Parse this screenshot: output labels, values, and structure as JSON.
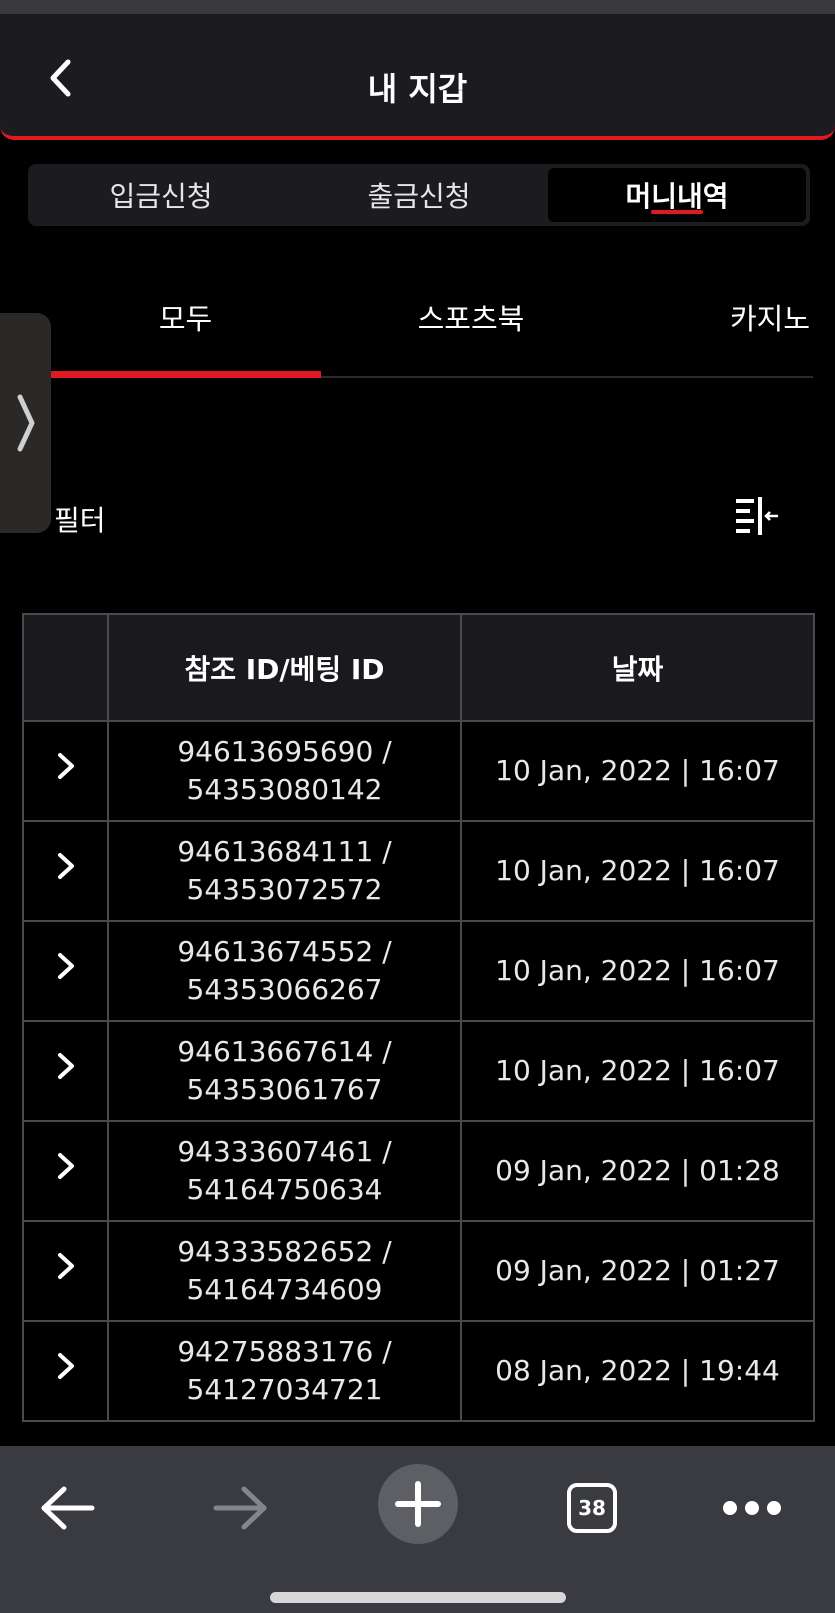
{
  "header": {
    "title": "내 지갑"
  },
  "segment": {
    "items": [
      "입금신청",
      "출금신청",
      "머니내역"
    ],
    "active": 2
  },
  "tabs": {
    "items": [
      "모두",
      "스포츠북",
      "카지노"
    ],
    "active": 0
  },
  "filter": {
    "label": "필터"
  },
  "table": {
    "columns": [
      "",
      "참조 ID/베팅 ID",
      "날짜"
    ],
    "rows": [
      {
        "ref_id": "94613695690 /",
        "bet_id": "54353080142",
        "date": "10 Jan, 2022 | 16:07"
      },
      {
        "ref_id": "94613684111 /",
        "bet_id": "54353072572",
        "date": "10 Jan, 2022 | 16:07"
      },
      {
        "ref_id": "94613674552 /",
        "bet_id": "54353066267",
        "date": "10 Jan, 2022 | 16:07"
      },
      {
        "ref_id": "94613667614 /",
        "bet_id": "54353061767",
        "date": "10 Jan, 2022 | 16:07"
      },
      {
        "ref_id": "94333607461 /",
        "bet_id": "54164750634",
        "date": "09 Jan, 2022 | 01:28"
      },
      {
        "ref_id": "94333582652 /",
        "bet_id": "54164734609",
        "date": "09 Jan, 2022 | 01:27"
      },
      {
        "ref_id": "94275883176 /",
        "bet_id": "54127034721",
        "date": "08 Jan, 2022 | 19:44"
      }
    ]
  },
  "browser": {
    "tab_count": "38"
  },
  "colors": {
    "accent": "#e01a22",
    "background": "#000000",
    "surface": "#1c1c20",
    "toolbar": "#3a3b40"
  },
  "icons": [
    "back-chevron-icon",
    "side-expand-chevron-icon",
    "filter-icon",
    "row-expand-chevron-icon",
    "browser-back-icon",
    "browser-forward-icon",
    "new-tab-plus-icon",
    "tab-switcher-icon",
    "more-dots-icon"
  ]
}
